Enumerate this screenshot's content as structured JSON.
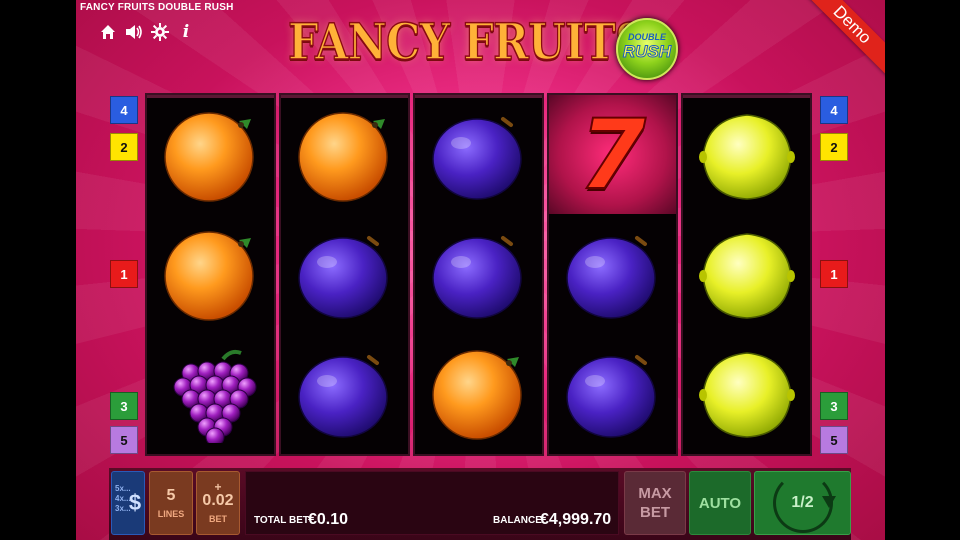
{
  "window": {
    "title": "FANCY FRUITS DOUBLE RUSH"
  },
  "logo": {
    "main_text": "FANCY FRUITS",
    "badge_top": "DOUBLE",
    "badge_bottom": "RUSH"
  },
  "demo_ribbon": "Demo",
  "top_icons": [
    "home-icon",
    "speaker-icon",
    "gear-icon",
    "info-icon"
  ],
  "line_markers": {
    "left": [
      "4",
      "2",
      "1",
      "3",
      "5"
    ],
    "right": [
      "4",
      "2",
      "1",
      "3",
      "5"
    ]
  },
  "reels": [
    [
      "orange",
      "orange",
      "grapes"
    ],
    [
      "orange",
      "plum",
      "plum"
    ],
    [
      "plum",
      "plum",
      "orange"
    ],
    [
      "seven",
      "plum",
      "plum"
    ],
    [
      "lemon",
      "lemon",
      "lemon"
    ]
  ],
  "seven_label": "7",
  "panel": {
    "currency_lines": [
      "5x...",
      "4x...",
      "3x..."
    ],
    "currency_symbol": "$",
    "lines_value": "5",
    "lines_label": "LINES",
    "bet_value": "0.02",
    "bet_label": "BET",
    "bet_up": "+",
    "bet_down": "−",
    "total_bet_label": "TOTAL BET",
    "total_bet_value": "€0.10",
    "balance_label": "BALANCE",
    "balance_value": "€4,999.70",
    "max_bet_line1": "MAX",
    "max_bet_line2": "BET",
    "auto_label": "AUTO",
    "spin_label": "1/2"
  },
  "colors": {
    "line_4": "#2a5de0",
    "line_2": "#ffe400",
    "line_1": "#e81b1b",
    "line_3": "#2b9d3a",
    "line_5": "#b77ae0",
    "background": "#c8125c",
    "ribbon": "#e0231b"
  }
}
